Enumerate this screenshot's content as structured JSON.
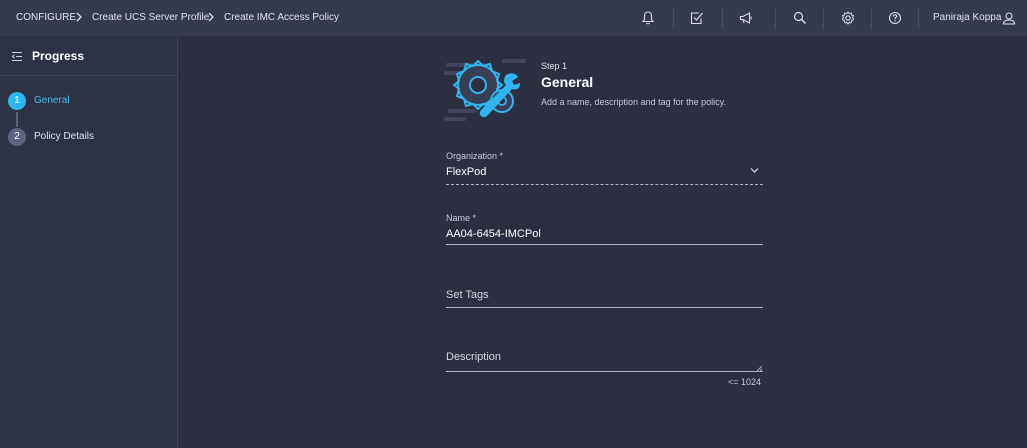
{
  "breadcrumb": {
    "items": [
      "CONFIGURE",
      "Create UCS Server Profile",
      "Create IMC Access Policy"
    ]
  },
  "header": {
    "icons": [
      "bell-icon",
      "tasks-check-icon",
      "megaphone-icon",
      "search-icon",
      "gear-icon",
      "help-icon",
      "user-icon"
    ],
    "user_name": "Paniraja Koppa"
  },
  "sidebar": {
    "title": "Progress",
    "steps": [
      {
        "number": "1",
        "label": "General",
        "active": true
      },
      {
        "number": "2",
        "label": "Policy Details",
        "active": false
      }
    ]
  },
  "main": {
    "step_number": "Step 1",
    "title": "General",
    "description": "Add a name, description and tag for the policy.",
    "organization": {
      "label": "Organization *",
      "value": "FlexPod"
    },
    "name": {
      "label": "Name *",
      "value": "AA04-6454-IMCPol"
    },
    "tags": {
      "placeholder": "Set Tags"
    },
    "description_field": {
      "placeholder": "Description",
      "counter": "<= 1024"
    }
  },
  "colors": {
    "accent": "#2fb6f0",
    "topbar": "#363a4d",
    "background": "#2b2f40",
    "sidebar": "#2e3245"
  }
}
